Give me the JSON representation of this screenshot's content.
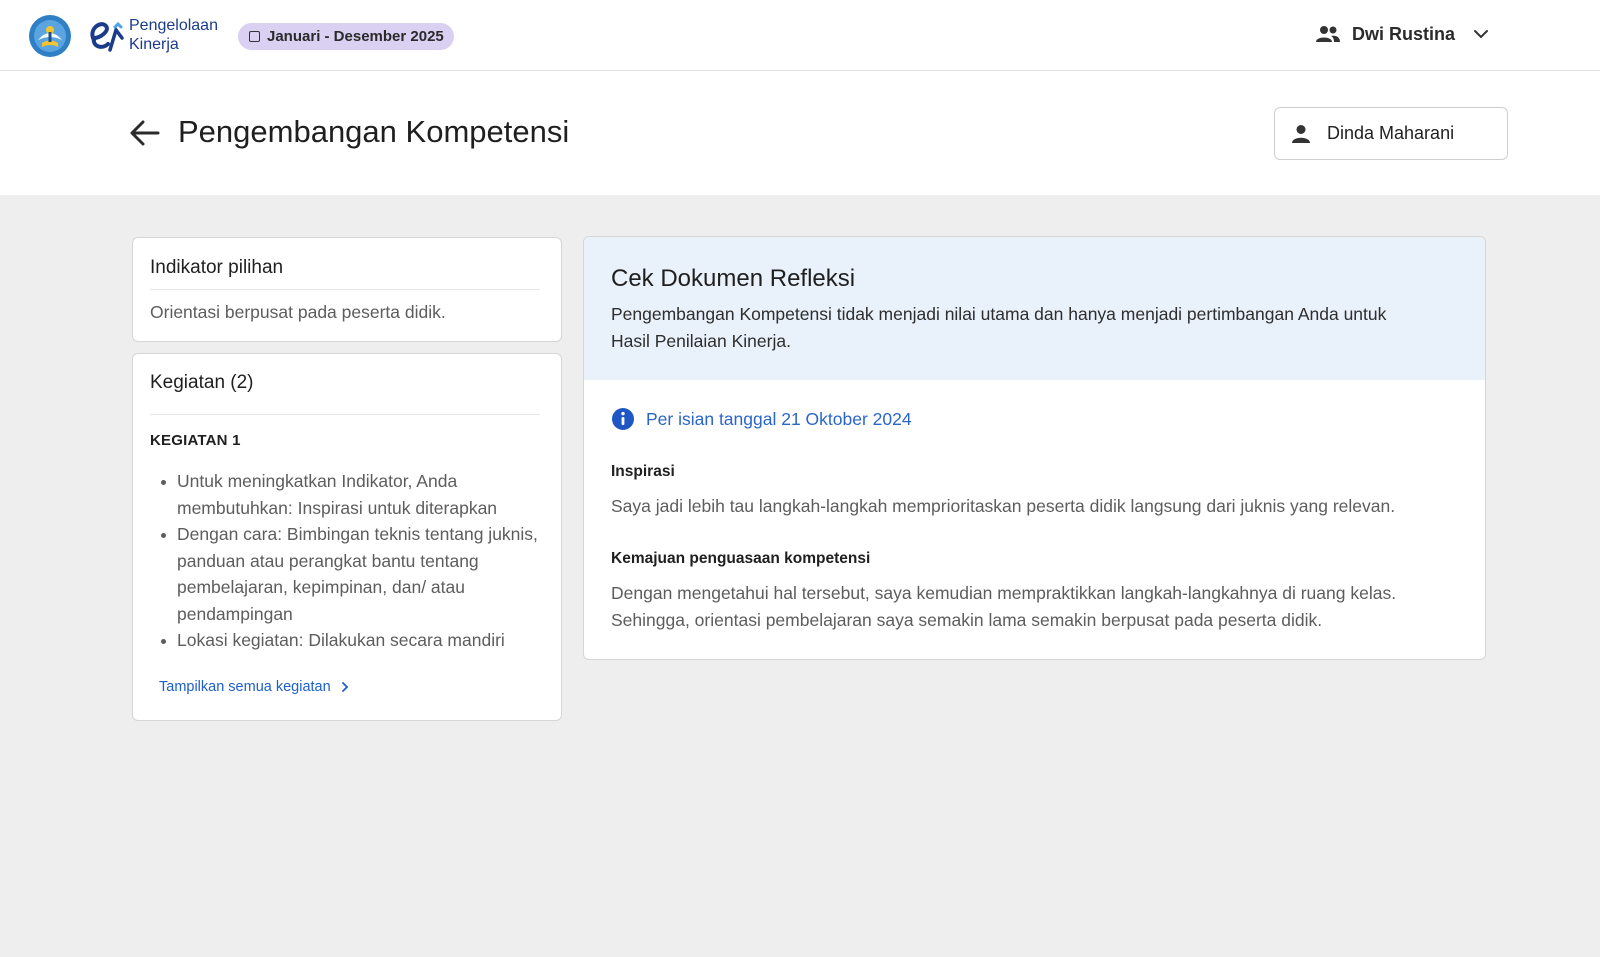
{
  "topbar": {
    "brand_line1": "Pengelolaan",
    "brand_line2": "Kinerja",
    "period": "Januari - Desember 2025",
    "user_name": "Dwi Rustina",
    "colors": {
      "brand": "#1c3b8a",
      "chip_bg": "#d9d0f2"
    }
  },
  "header": {
    "title": "Pengembangan Kompetensi",
    "person_button": "Dinda Maharani"
  },
  "indikator": {
    "title": "Indikator pilihan",
    "value": "Orientasi berpusat pada peserta didik."
  },
  "kegiatan": {
    "title": "Kegiatan (2)",
    "item_heading": "KEGIATAN 1",
    "points": [
      "Untuk meningkatkan Indikator, Anda membutuhkan: Inspirasi untuk diterapkan",
      "Dengan cara: Bimbingan teknis tentang juknis, panduan atau perangkat bantu tentang pembelajaran, kepimpinan, dan/ atau pendampingan",
      "Lokasi kegiatan: Dilakukan secara mandiri"
    ],
    "show_all": "Tampilkan semua kegiatan"
  },
  "dokumen": {
    "title": "Cek Dokumen Refleksi",
    "description": "Pengembangan Kompetensi tidak menjadi nilai utama dan hanya menjadi pertimbangan Anda untuk Hasil Penilaian Kinerja.",
    "date_note": "Per isian tanggal 21 Oktober 2024",
    "inspirasi_label": "Inspirasi",
    "inspirasi_text": "Saya jadi lebih tau langkah-langkah memprioritaskan peserta didik langsung dari juknis yang relevan.",
    "kemajuan_label": "Kemajuan penguasaan kompetensi",
    "kemajuan_text": "Dengan mengetahui hal tersebut, saya kemudian mempraktikkan langkah-langkahnya di ruang kelas. Sehingga, orientasi pembelajaran saya semakin lama semakin berpusat pada peserta didik.",
    "colors": {
      "head_bg": "#e9f1fb",
      "link": "#2a66c9"
    }
  }
}
